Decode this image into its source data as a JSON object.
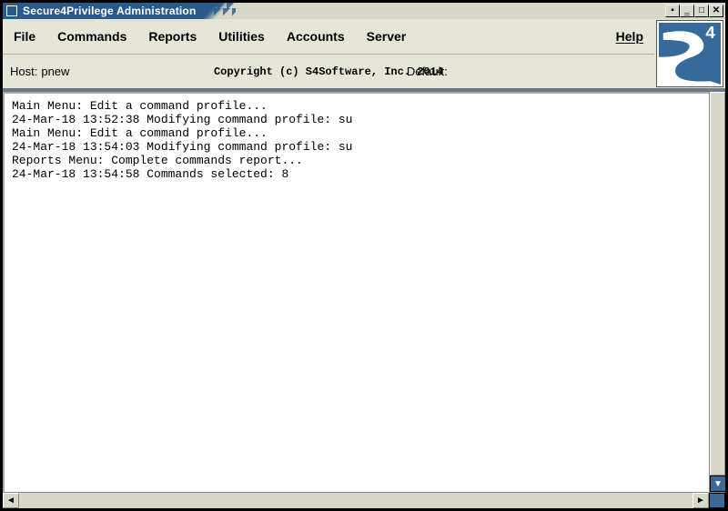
{
  "window": {
    "title": "Secure4Privilege Administration"
  },
  "menu": {
    "file": "File",
    "commands": "Commands",
    "reports": "Reports",
    "utilities": "Utilities",
    "accounts": "Accounts",
    "server": "Server",
    "help": "Help"
  },
  "status": {
    "host_label": "Host:",
    "host_value": "pnew",
    "copyright": "Copyright (c) S4Software, Inc. 2014",
    "default_label": "Default:"
  },
  "logo": {
    "text_s": "S",
    "text_4": "4"
  },
  "log_lines": [
    "Main Menu: Edit a command profile...",
    "24-Mar-18 13:52:38 Modifying command profile: su",
    "Main Menu: Edit a command profile...",
    "24-Mar-18 13:54:03 Modifying command profile: su",
    "Reports Menu: Complete commands report...",
    "24-Mar-18 13:54:58 Commands selected: 8"
  ]
}
